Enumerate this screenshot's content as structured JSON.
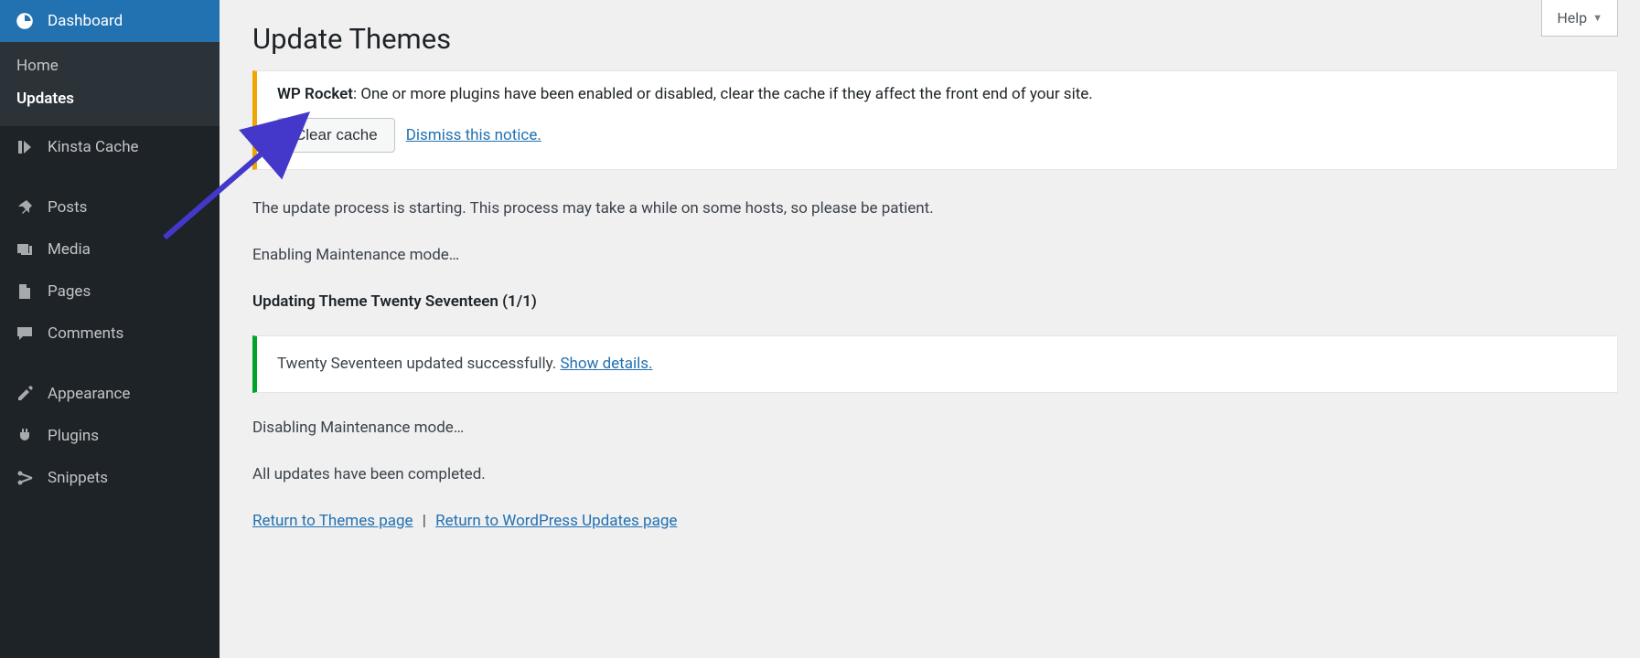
{
  "help": {
    "label": "Help"
  },
  "sidebar": {
    "dashboard": "Dashboard",
    "submenu": {
      "home": "Home",
      "updates": "Updates"
    },
    "kinsta": "Kinsta Cache",
    "posts": "Posts",
    "media": "Media",
    "pages": "Pages",
    "comments": "Comments",
    "appearance": "Appearance",
    "plugins": "Plugins",
    "snippets": "Snippets"
  },
  "page": {
    "title": "Update Themes"
  },
  "notice": {
    "strong": "WP Rocket",
    "text": ": One or more plugins have been enabled or disabled, clear the cache if they affect the front end of your site.",
    "clear_btn": "Clear cache",
    "dismiss": "Dismiss this notice."
  },
  "process": {
    "starting": "The update process is starting. This process may take a while on some hosts, so please be patient.",
    "enabling": "Enabling Maintenance mode…",
    "updating_theme": "Updating Theme Twenty Seventeen (1/1)",
    "success_text": "Twenty Seventeen updated successfully. ",
    "show_details": "Show details.",
    "disabling": "Disabling Maintenance mode…",
    "completed": "All updates have been completed.",
    "return_themes": "Return to Themes page",
    "return_updates": "Return to WordPress Updates page"
  }
}
